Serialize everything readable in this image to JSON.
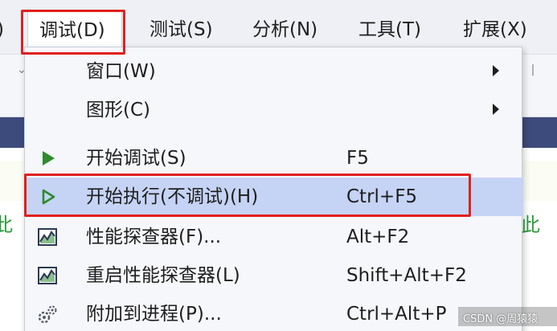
{
  "menubar": {
    "items": [
      {
        "label": ")"
      },
      {
        "label": "调试(D)"
      },
      {
        "label": "测试(S)"
      },
      {
        "label": "分析(N)"
      },
      {
        "label": "工具(T)"
      },
      {
        "label": "扩展(X)"
      }
    ]
  },
  "debug_menu": {
    "items": [
      {
        "label": "窗口(W)",
        "shortcut": "",
        "icon": "none",
        "submenu": true
      },
      {
        "label": "图形(C)",
        "shortcut": "",
        "icon": "none",
        "submenu": true
      },
      {
        "label": "开始调试(S)",
        "shortcut": "F5",
        "icon": "play-filled-icon"
      },
      {
        "label": "开始执行(不调试)(H)",
        "shortcut": "Ctrl+F5",
        "icon": "play-outline-icon",
        "selected": true
      },
      {
        "label": "性能探查器(F)...",
        "shortcut": "Alt+F2",
        "icon": "performance-chart-icon"
      },
      {
        "label": "重启性能探查器(L)",
        "shortcut": "Shift+Alt+F2",
        "icon": "performance-chart-icon"
      },
      {
        "label": "附加到进程(P)...",
        "shortcut": "Ctrl+Alt+P",
        "icon": "attach-gears-icon"
      }
    ]
  },
  "background": {
    "green_text_left": "此",
    "green_text_right": "此"
  },
  "watermark": "CSDN @周猿猿",
  "colors": {
    "highlight_red": "#e0201f",
    "selected_bg": "#c5d3f5",
    "play_green": "#2e8b2e",
    "toolbar_blue": "#3d4b7c"
  }
}
